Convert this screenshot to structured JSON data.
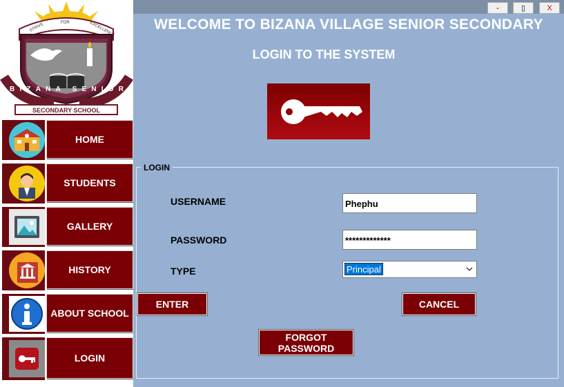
{
  "window": {
    "title": "WELCOME TO BIZANA VILLAGE SENIOR SECONDARY",
    "subtitle": "LOGIN TO THE SYSTEM",
    "controls": {
      "minimize": "-",
      "maximize": "▯",
      "close": "X"
    }
  },
  "logo": {
    "motto_left": "STRIVE",
    "motto_center": "FOR",
    "motto_right": "EXCELLENCE",
    "arc_text": "BIZANA  SENIOR",
    "banner_text": "SECONDARY SCHOOL"
  },
  "sidebar": {
    "items": [
      {
        "label": "HOME",
        "icon": "school-building-icon"
      },
      {
        "label": "STUDENTS",
        "icon": "student-avatar-icon"
      },
      {
        "label": "GALLERY",
        "icon": "picture-icon"
      },
      {
        "label": "HISTORY",
        "icon": "history-building-icon"
      },
      {
        "label": "ABOUT SCHOOL",
        "icon": "info-icon"
      },
      {
        "label": "LOGIN",
        "icon": "key-icon"
      }
    ]
  },
  "login": {
    "group_label": "LOGIN",
    "username_label": "USERNAME",
    "username_value": "Phephu",
    "password_label": "PASSWORD",
    "password_value": "*************",
    "type_label": "TYPE",
    "type_value": "Principal",
    "enter_label": "ENTER",
    "cancel_label": "CANCEL",
    "forgot_line1": "FORGOT",
    "forgot_line2": "PASSWORD"
  },
  "colors": {
    "accent": "#7b0006",
    "panel": "#97b0d2",
    "topbar": "#7d8fa4",
    "selection": "#0078d7"
  }
}
